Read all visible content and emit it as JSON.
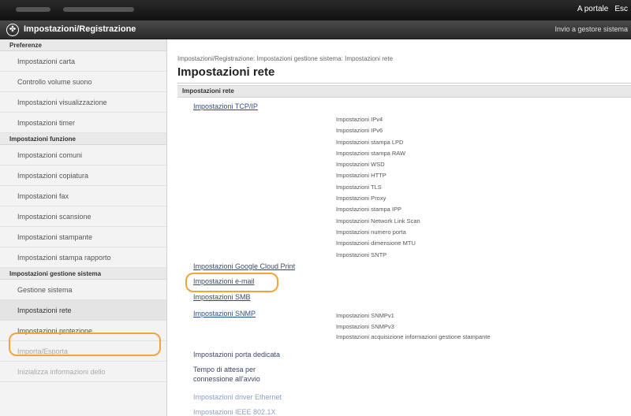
{
  "topbar": {
    "portal_link": "A portale",
    "exit_link": "Esc"
  },
  "header": {
    "title": "Impostazioni/Registrazione",
    "mail_link": "Invio a gestore sistema"
  },
  "sidebar": {
    "groups": [
      {
        "heading": "Preferenze",
        "items": [
          "Impostazioni carta",
          "Controllo volume suono",
          "Impostazioni visualizzazione",
          "Impostazioni timer"
        ]
      },
      {
        "heading": "Impostazioni funzione",
        "items": [
          "Impostazioni comuni",
          "Impostazioni copiatura",
          "Impostazioni fax",
          "Impostazioni scansione",
          "Impostazioni stampante",
          "Impostazioni stampa rapporto"
        ]
      },
      {
        "heading": "Impostazioni gestione sistema",
        "items": [
          "Gestione sistema",
          "Impostazioni rete",
          "Impostazioni protezione",
          "Importa/Esporta",
          "Inizializza informazioni dello"
        ]
      }
    ]
  },
  "main": {
    "breadcrumb": "Impostazioni/Registrazione: Impostazioni gestione sistema: Impostazioni rete",
    "title": "Impostazioni rete",
    "section_title": "Impostazioni rete",
    "tcpip": {
      "label": "Impostazioni TCP/IP",
      "sub": [
        "Impostazioni IPv4",
        "Impostazioni IPv6",
        "Impostazioni stampa LPD",
        "Impostazioni stampa RAW",
        "Impostazioni WSD",
        "Impostazioni HTTP",
        "Impostazioni TLS",
        "Impostazioni Proxy",
        "Impostazioni stampa IPP",
        "Impostazioni Network Link Scan",
        "Impostazioni numero porta",
        "Impostazioni dimensione MTU",
        "Impostazioni SNTP"
      ]
    },
    "links": {
      "google_cloud": "Impostazioni Google Cloud Print",
      "email": "Impostazioni e-mail",
      "smb": "Impostazioni SMB",
      "snmp": "Impostazioni SNMP",
      "dedicated_port": "Impostazioni porta dedicata",
      "wait_time": "Tempo di attesa per connessione all'avvio",
      "ethernet_driver": "Impostazioni driver Ethernet",
      "ieee": "Impostazioni IEEE 802.1X"
    },
    "snmp_sub": [
      "Impostazioni SNMPv1",
      "Impostazioni SNMPv3",
      "Impostazioni acquisizione informazioni gestione stampante"
    ]
  },
  "colors": {
    "highlight": "#f2a33a",
    "link": "#2a4f8c"
  }
}
